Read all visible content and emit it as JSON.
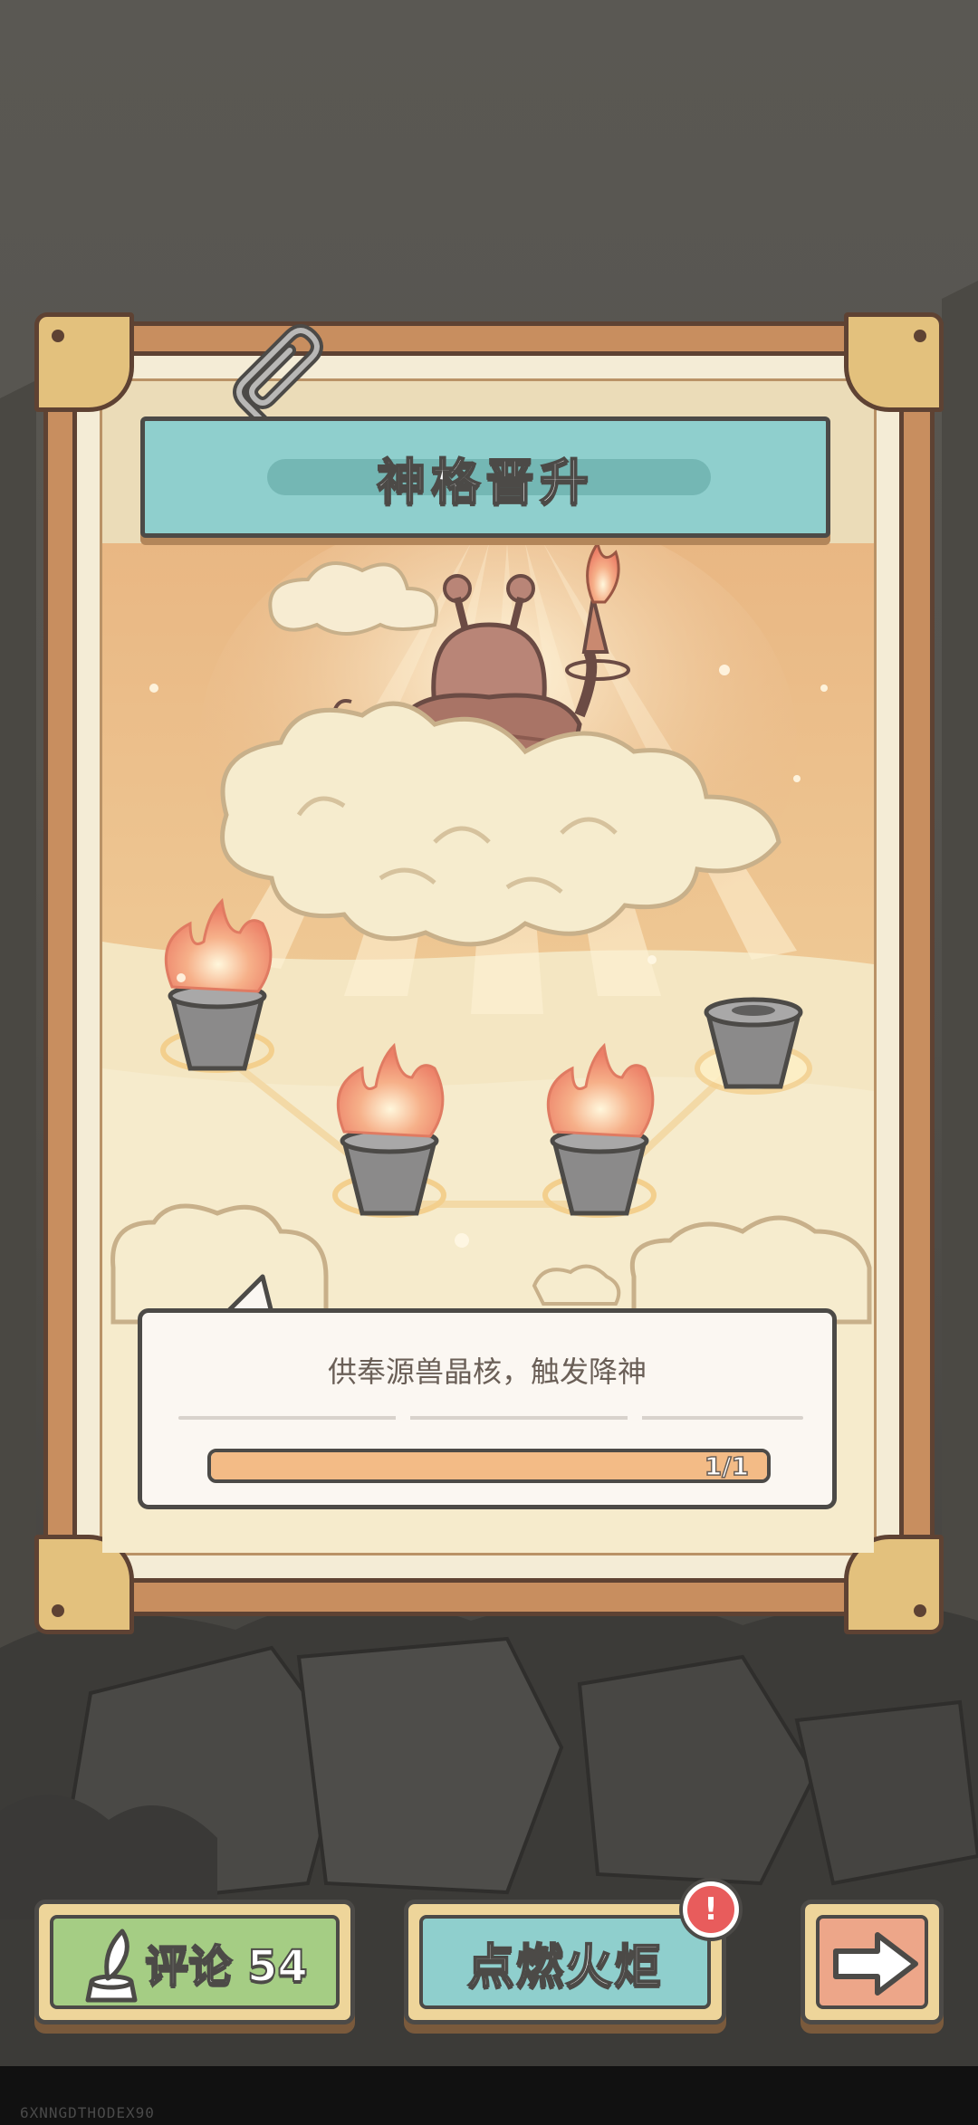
{
  "panel": {
    "title": "神格晋升"
  },
  "quest": {
    "description": "供奉源兽晶核，触发降神",
    "progress_label": "1/1",
    "progress_fraction": 1.0
  },
  "torches": [
    {
      "name": "torch-1",
      "lit": true
    },
    {
      "name": "torch-2",
      "lit": true
    },
    {
      "name": "torch-3",
      "lit": true
    },
    {
      "name": "torch-4",
      "lit": false
    }
  ],
  "bottom_bar": {
    "comment_label": "评论 54",
    "light_torch_label": "点燃火炬",
    "alert_badge": "!",
    "next_icon": "arrow-right-icon"
  },
  "watermark": "6XNNGDTHODEX90",
  "colors": {
    "teal": "#8fcfcd",
    "green": "#a5cd84",
    "peach": "#eda689",
    "frame": "#c88e5f",
    "alert": "#e85c5c",
    "progress": "#f3bb86"
  }
}
